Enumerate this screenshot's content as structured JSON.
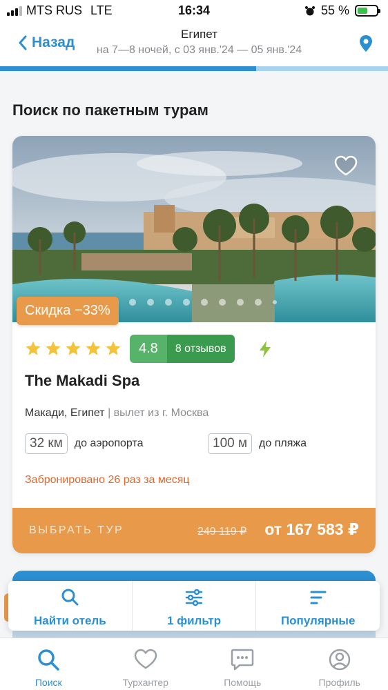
{
  "status_bar": {
    "carrier": "MTS RUS",
    "network": "LTE",
    "time": "16:34",
    "battery_percent": "55 %",
    "battery_level": 0.55
  },
  "header": {
    "back_label": "Назад",
    "title": "Египет",
    "subtitle": "на 7—8 ночей, с 03 янв.'24 — 05 янв.'24",
    "progress": 0.66
  },
  "section_title": "Поиск по пакетным турам",
  "hotel_card": {
    "discount": "Скидка −33%",
    "photo_count": 10,
    "photo_active_index": 0,
    "stars": 5,
    "rating": "4.8",
    "reviews": "8 отзывов",
    "name": "The Makadi Spa",
    "location": "Макади, Египет",
    "departure": "| вылет из г. Москва",
    "airport_distance": "32 км",
    "airport_label": "до аэропорта",
    "beach_distance": "100 м",
    "beach_label": "до пляжа",
    "booked": "Забронировано 26 раз за месяц",
    "select_label": "ВЫБРАТЬ ТУР",
    "old_price": "249 119 ₽",
    "price": "от 167 583 ₽"
  },
  "filter_bar": {
    "find_hotel": "Найти отель",
    "filters": "1 фильтр",
    "sort": "Популярные"
  },
  "tab_bar": [
    {
      "label": "Поиск",
      "icon": "search-icon",
      "active": true
    },
    {
      "label": "Турхантер",
      "icon": "heart-icon",
      "active": false
    },
    {
      "label": "Помощь",
      "icon": "chat-icon",
      "active": false
    },
    {
      "label": "Профиль",
      "icon": "profile-icon",
      "active": false
    }
  ],
  "colors": {
    "accent": "#2b8fd2",
    "orange": "#e89a4a",
    "rating_green": "#58b36a",
    "booked_text": "#e2672c"
  }
}
